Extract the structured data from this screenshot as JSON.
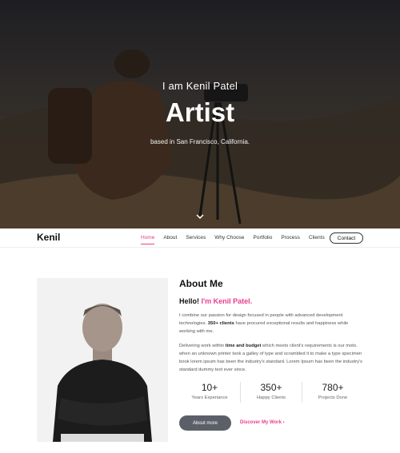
{
  "hero": {
    "intro": "I am Kenil Patel",
    "title": "Artist",
    "subtitle": "based in San Francisco, California."
  },
  "nav": {
    "brand": "Kenil",
    "items": [
      {
        "label": "Home",
        "active": true
      },
      {
        "label": "About"
      },
      {
        "label": "Services"
      },
      {
        "label": "Why Choose"
      },
      {
        "label": "Portfolio"
      },
      {
        "label": "Process"
      },
      {
        "label": "Clients"
      }
    ],
    "contact": "Contact"
  },
  "about": {
    "title": "About Me",
    "hello_prefix": "Hello! ",
    "hello_name": "I'm Kenil Patel.",
    "p1_start": "I combine our passion for design focused in people with advanced development technologies. ",
    "p1_bold": "350+ clients",
    "p1_end": " have procured exceptional results and happiness while working with me.",
    "p2_start": "Delivering work within ",
    "p2_bold": "time and budget",
    "p2_end": " which meets client's requirements is our moto. when an unknown printer took a galley of type and scrambled it to make a type specimen book lorem ipsum has been the industry's standard. Lorem Ipsum has been the industry's standard dummy text ever since.",
    "stats": [
      {
        "num": "10+",
        "label": "Years Experiance"
      },
      {
        "num": "350+",
        "label": "Happy Clients"
      },
      {
        "num": "780+",
        "label": "Projects Done"
      }
    ],
    "btn_about": "About more",
    "btn_discover": "Discover My Work"
  },
  "colors": {
    "accent": "#e83e8c",
    "button": "#5b6068"
  }
}
